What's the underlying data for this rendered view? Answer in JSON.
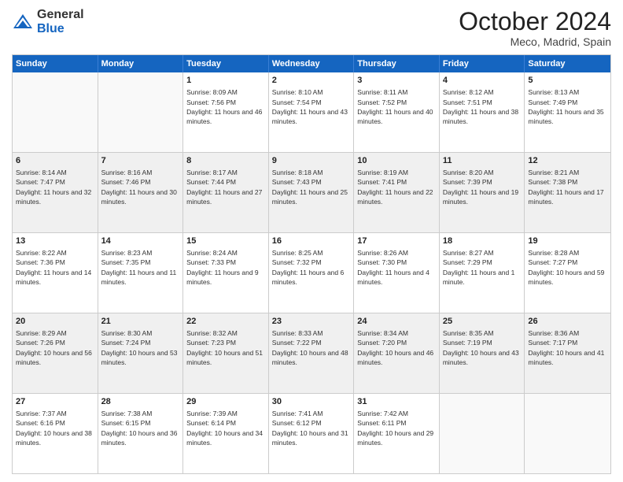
{
  "header": {
    "logo_general": "General",
    "logo_blue": "Blue",
    "month_title": "October 2024",
    "location": "Meco, Madrid, Spain"
  },
  "weekdays": [
    "Sunday",
    "Monday",
    "Tuesday",
    "Wednesday",
    "Thursday",
    "Friday",
    "Saturday"
  ],
  "rows": [
    [
      {
        "day": "",
        "text": "",
        "empty": true
      },
      {
        "day": "",
        "text": "",
        "empty": true
      },
      {
        "day": "1",
        "text": "Sunrise: 8:09 AM\nSunset: 7:56 PM\nDaylight: 11 hours and 46 minutes."
      },
      {
        "day": "2",
        "text": "Sunrise: 8:10 AM\nSunset: 7:54 PM\nDaylight: 11 hours and 43 minutes."
      },
      {
        "day": "3",
        "text": "Sunrise: 8:11 AM\nSunset: 7:52 PM\nDaylight: 11 hours and 40 minutes."
      },
      {
        "day": "4",
        "text": "Sunrise: 8:12 AM\nSunset: 7:51 PM\nDaylight: 11 hours and 38 minutes."
      },
      {
        "day": "5",
        "text": "Sunrise: 8:13 AM\nSunset: 7:49 PM\nDaylight: 11 hours and 35 minutes."
      }
    ],
    [
      {
        "day": "6",
        "text": "Sunrise: 8:14 AM\nSunset: 7:47 PM\nDaylight: 11 hours and 32 minutes.",
        "shaded": true
      },
      {
        "day": "7",
        "text": "Sunrise: 8:16 AM\nSunset: 7:46 PM\nDaylight: 11 hours and 30 minutes.",
        "shaded": true
      },
      {
        "day": "8",
        "text": "Sunrise: 8:17 AM\nSunset: 7:44 PM\nDaylight: 11 hours and 27 minutes.",
        "shaded": true
      },
      {
        "day": "9",
        "text": "Sunrise: 8:18 AM\nSunset: 7:43 PM\nDaylight: 11 hours and 25 minutes.",
        "shaded": true
      },
      {
        "day": "10",
        "text": "Sunrise: 8:19 AM\nSunset: 7:41 PM\nDaylight: 11 hours and 22 minutes.",
        "shaded": true
      },
      {
        "day": "11",
        "text": "Sunrise: 8:20 AM\nSunset: 7:39 PM\nDaylight: 11 hours and 19 minutes.",
        "shaded": true
      },
      {
        "day": "12",
        "text": "Sunrise: 8:21 AM\nSunset: 7:38 PM\nDaylight: 11 hours and 17 minutes.",
        "shaded": true
      }
    ],
    [
      {
        "day": "13",
        "text": "Sunrise: 8:22 AM\nSunset: 7:36 PM\nDaylight: 11 hours and 14 minutes."
      },
      {
        "day": "14",
        "text": "Sunrise: 8:23 AM\nSunset: 7:35 PM\nDaylight: 11 hours and 11 minutes."
      },
      {
        "day": "15",
        "text": "Sunrise: 8:24 AM\nSunset: 7:33 PM\nDaylight: 11 hours and 9 minutes."
      },
      {
        "day": "16",
        "text": "Sunrise: 8:25 AM\nSunset: 7:32 PM\nDaylight: 11 hours and 6 minutes."
      },
      {
        "day": "17",
        "text": "Sunrise: 8:26 AM\nSunset: 7:30 PM\nDaylight: 11 hours and 4 minutes."
      },
      {
        "day": "18",
        "text": "Sunrise: 8:27 AM\nSunset: 7:29 PM\nDaylight: 11 hours and 1 minute."
      },
      {
        "day": "19",
        "text": "Sunrise: 8:28 AM\nSunset: 7:27 PM\nDaylight: 10 hours and 59 minutes."
      }
    ],
    [
      {
        "day": "20",
        "text": "Sunrise: 8:29 AM\nSunset: 7:26 PM\nDaylight: 10 hours and 56 minutes.",
        "shaded": true
      },
      {
        "day": "21",
        "text": "Sunrise: 8:30 AM\nSunset: 7:24 PM\nDaylight: 10 hours and 53 minutes.",
        "shaded": true
      },
      {
        "day": "22",
        "text": "Sunrise: 8:32 AM\nSunset: 7:23 PM\nDaylight: 10 hours and 51 minutes.",
        "shaded": true
      },
      {
        "day": "23",
        "text": "Sunrise: 8:33 AM\nSunset: 7:22 PM\nDaylight: 10 hours and 48 minutes.",
        "shaded": true
      },
      {
        "day": "24",
        "text": "Sunrise: 8:34 AM\nSunset: 7:20 PM\nDaylight: 10 hours and 46 minutes.",
        "shaded": true
      },
      {
        "day": "25",
        "text": "Sunrise: 8:35 AM\nSunset: 7:19 PM\nDaylight: 10 hours and 43 minutes.",
        "shaded": true
      },
      {
        "day": "26",
        "text": "Sunrise: 8:36 AM\nSunset: 7:17 PM\nDaylight: 10 hours and 41 minutes.",
        "shaded": true
      }
    ],
    [
      {
        "day": "27",
        "text": "Sunrise: 7:37 AM\nSunset: 6:16 PM\nDaylight: 10 hours and 38 minutes."
      },
      {
        "day": "28",
        "text": "Sunrise: 7:38 AM\nSunset: 6:15 PM\nDaylight: 10 hours and 36 minutes."
      },
      {
        "day": "29",
        "text": "Sunrise: 7:39 AM\nSunset: 6:14 PM\nDaylight: 10 hours and 34 minutes."
      },
      {
        "day": "30",
        "text": "Sunrise: 7:41 AM\nSunset: 6:12 PM\nDaylight: 10 hours and 31 minutes."
      },
      {
        "day": "31",
        "text": "Sunrise: 7:42 AM\nSunset: 6:11 PM\nDaylight: 10 hours and 29 minutes."
      },
      {
        "day": "",
        "text": "",
        "empty": true
      },
      {
        "day": "",
        "text": "",
        "empty": true
      }
    ]
  ]
}
